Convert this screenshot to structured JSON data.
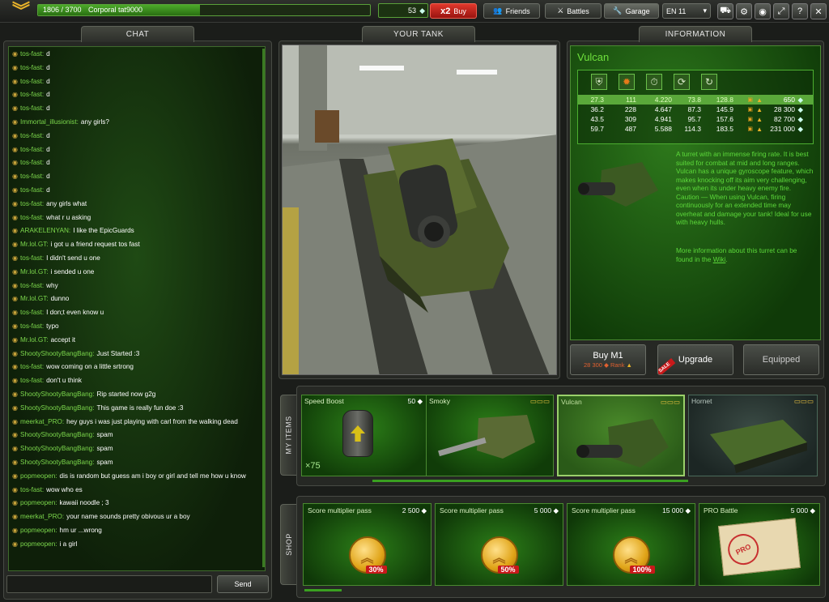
{
  "topbar": {
    "rank_progress": "1806 / 3700",
    "rank_name": "Corporal tat9000",
    "progress_fraction": 0.488,
    "crystals": "53",
    "multiplier": "x2",
    "buy_label": "Buy",
    "friends_label": "Friends",
    "battles_label": "Battles",
    "garage_label": "Garage",
    "server": "EN 11"
  },
  "chat": {
    "tab_label": "CHAT",
    "send_label": "Send",
    "input_placeholder": "",
    "messages": [
      {
        "name": "tos-fast:",
        "text": "d"
      },
      {
        "name": "tos-fast:",
        "text": "d"
      },
      {
        "name": "tos-fast:",
        "text": "d"
      },
      {
        "name": "tos-fast:",
        "text": "d"
      },
      {
        "name": "tos-fast:",
        "text": "d"
      },
      {
        "name": "Immortal_illusionist:",
        "text": "any girls?"
      },
      {
        "name": "tos-fast:",
        "text": "d"
      },
      {
        "name": "tos-fast:",
        "text": "d"
      },
      {
        "name": "tos-fast:",
        "text": "d"
      },
      {
        "name": "tos-fast:",
        "text": "d"
      },
      {
        "name": "tos-fast:",
        "text": "d"
      },
      {
        "name": "tos-fast:",
        "text": "any girls what"
      },
      {
        "name": "tos-fast:",
        "text": "what r u asking"
      },
      {
        "name": "ARAKELENYAN:",
        "text": "I like the EpicGuards"
      },
      {
        "name": "Mr.lol.GT:",
        "text": "i got u a friend request tos fast"
      },
      {
        "name": "tos-fast:",
        "text": "I didn't send u one"
      },
      {
        "name": "Mr.lol.GT:",
        "text": "i sended u one"
      },
      {
        "name": "tos-fast:",
        "text": "why"
      },
      {
        "name": "Mr.lol.GT:",
        "text": "dunno"
      },
      {
        "name": "tos-fast:",
        "text": "I don;t even know u"
      },
      {
        "name": "tos-fast:",
        "text": "typo"
      },
      {
        "name": "Mr.lol.GT:",
        "text": "accept it"
      },
      {
        "name": "ShootyShootyBangBang:",
        "text": "Just Started :3"
      },
      {
        "name": "tos-fast:",
        "text": "wow coming on a little srtrong"
      },
      {
        "name": "tos-fast:",
        "text": "don't u think"
      },
      {
        "name": "ShootyShootyBangBang:",
        "text": "Rip started now g2g"
      },
      {
        "name": "ShootyShootyBangBang:",
        "text": "This game is really fun doe :3"
      },
      {
        "name": "meerkat_PRO:",
        "text": "hey guys i was just playing with carl from the walking dead"
      },
      {
        "name": "ShootyShootyBangBang:",
        "text": "spam"
      },
      {
        "name": "ShootyShootyBangBang:",
        "text": "spam"
      },
      {
        "name": "ShootyShootyBangBang:",
        "text": "spam"
      },
      {
        "name": "popmeopen:",
        "text": "dis is random but guess am i boy or girl and tell me how u know"
      },
      {
        "name": "tos-fast:",
        "text": "wow who es"
      },
      {
        "name": "popmeopen:",
        "text": "kawaii noodle ; 3"
      },
      {
        "name": "meerkat_PRO:",
        "text": "your name sounds pretty obivous ur a boy"
      },
      {
        "name": "popmeopen:",
        "text": "hm ur ...wrong"
      },
      {
        "name": "popmeopen:",
        "text": "i a girl"
      }
    ]
  },
  "tank": {
    "tab_label": "YOUR TANK"
  },
  "info": {
    "tab_label": "INFORMATION",
    "title": "Vulcan",
    "stats": [
      {
        "v": [
          "27.3",
          "111",
          "4.220",
          "73.8",
          "128.8"
        ],
        "price": "650",
        "current": true
      },
      {
        "v": [
          "36.2",
          "228",
          "4.647",
          "87.3",
          "145.9"
        ],
        "price": "28 300",
        "current": false
      },
      {
        "v": [
          "43.5",
          "309",
          "4.941",
          "95.7",
          "157.6"
        ],
        "price": "82 700",
        "current": false
      },
      {
        "v": [
          "59.7",
          "487",
          "5.588",
          "114.3",
          "183.5"
        ],
        "price": "231 000",
        "current": false
      }
    ],
    "description": "A turret with an immense firing rate. It is best suited for combat at mid and long ranges. Vulcan has a unique gyroscope feature, which makes knocking off its aim very challenging, even when its under heavy enemy fire. Caution — When using Vulcan, firing continuously for an extended time may overheat and damage your tank! Ideal for use with heavy hulls.",
    "more_info": "More information about this turret can be found in the",
    "wiki": "Wiki",
    "buy_label": "Buy M1",
    "buy_price": "28 300",
    "buy_rank": "Rank",
    "sale_badge": "SALE",
    "upgrade_label": "Upgrade",
    "equipped_label": "Equipped"
  },
  "items": {
    "tab_label": "MY ITEMS",
    "list": [
      {
        "name": "Speed Boost",
        "price": "50",
        "count": "×75"
      },
      {
        "name": "Smoky",
        "price": ""
      },
      {
        "name": "Vulcan",
        "price": ""
      },
      {
        "name": "Hornet",
        "price": ""
      }
    ]
  },
  "shop": {
    "tab_label": "SHOP",
    "list": [
      {
        "name": "Score multiplier pass",
        "price": "2 500",
        "pct": "30%"
      },
      {
        "name": "Score multiplier pass",
        "price": "5 000",
        "pct": "50%"
      },
      {
        "name": "Score multiplier pass",
        "price": "15 000",
        "pct": "100%"
      },
      {
        "name": "PRO Battle",
        "price": "5 000",
        "stamp": "PRO"
      }
    ]
  }
}
